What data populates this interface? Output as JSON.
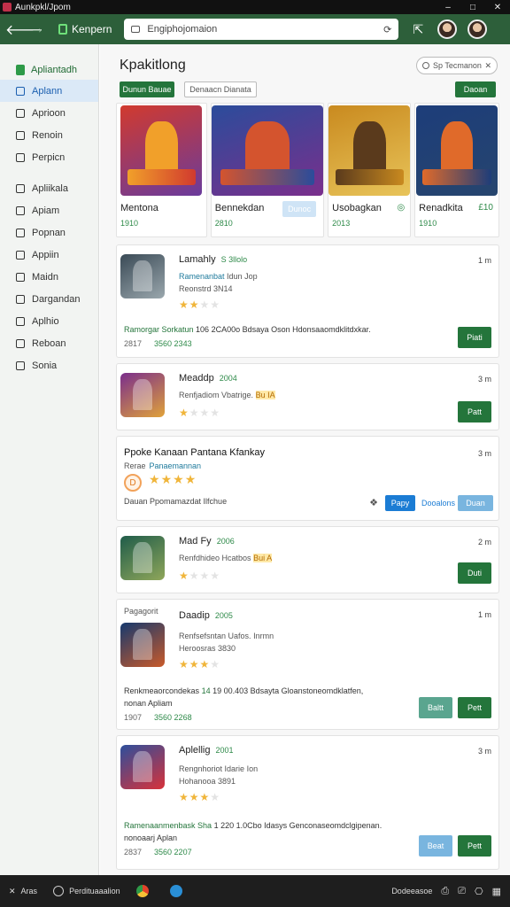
{
  "window": {
    "title": "Aunkpkl/Jpom",
    "min": "–",
    "max": "□",
    "close": "✕"
  },
  "toolbar": {
    "back": "🡐",
    "forward": "→",
    "tab_label": "Kenpern",
    "address": "Engiphojomaion",
    "refresh": "⟳"
  },
  "sidebar": {
    "brand": "Apliantadh",
    "items": [
      "Aplann",
      "Aprioon",
      "Renoin",
      "Perpicn",
      "Apliikala",
      "Apiam",
      "Popnan",
      "Appiin",
      "Maidn",
      "Dargandan",
      "Aplhio",
      "Reboan",
      "Sonia"
    ]
  },
  "main": {
    "title": "Kpakitlong",
    "search": "Sp Tecmanon",
    "chip_primary": "Dunun Bauae",
    "chip_secondary": "Denaacn Dianata",
    "chip_right": "Daoan"
  },
  "featured": [
    {
      "name": "Mentona",
      "sub": "1910",
      "colors": [
        "#d13a2e",
        "#f1a02a",
        "#6a3b9c"
      ]
    },
    {
      "name": "Bennekdan",
      "sub": "2810",
      "button": "Dunoc",
      "colors": [
        "#2b4c9b",
        "#d4542e",
        "#7a2f8c"
      ]
    },
    {
      "name": "Usobagkan",
      "sub": "2013",
      "mark": "◎",
      "colors": [
        "#c98a1f",
        "#5a3a1c",
        "#e8c45a"
      ]
    },
    {
      "name": "Renadkita",
      "sub": "1910",
      "mark": "£10",
      "colors": [
        "#1d3d7a",
        "#e06a2a",
        "#26456e"
      ]
    }
  ],
  "apps": [
    {
      "name": "Lamahly",
      "tag": "S 3llolo",
      "sub_hl": "Ramenanbat",
      "sub_rest": " Idun Jop",
      "sub2": "Reonstrd 3N14",
      "rating": 2,
      "desc_g": "Ramorgar Sorkatun",
      "desc_rest": " 106 2CA00o Bdsaya Oson Hdonsaaomdklitdxkar.",
      "meta1": "2817",
      "meta2": "3560 2343",
      "size": "1 m",
      "button": "Piati",
      "colors": [
        "#3a4a56",
        "#9aa7ad"
      ]
    },
    {
      "name": "Meaddp",
      "tag": "2004",
      "sub_text": "Renfjadiom Vbatrige.",
      "sub_hl2": "Bu IA",
      "rating": 1,
      "size": "3 m",
      "button": "Patt",
      "colors": [
        "#7a2e8c",
        "#e0a23a"
      ]
    },
    {
      "name": "Mad Fy",
      "tag": "2006",
      "sub_text": "Renfdhideo Hcatbos",
      "sub_hl2": "Bui A",
      "rating": 1,
      "size": "2 m",
      "button": "Duti",
      "colors": [
        "#1f5c4a",
        "#8fa65a"
      ]
    },
    {
      "name": "Daadip",
      "tag": "2005",
      "label_top": "Pagagorit",
      "sub_text": "Renfsefsntan Uafos.",
      "sub_text_b": "Inrmn",
      "sub2": "Heroosras 3830",
      "rating": 3,
      "desc_g": "14",
      "desc_a": "Renkmeaorcondekas",
      "desc_rest": " 19 00.403 Bdsayta Gloanstoneomdklatfen,",
      "desc2": "nonan Apliam",
      "meta1": "1907",
      "meta2": "3560 2268",
      "size": "1 m",
      "button": "Pett",
      "button2": "Baltt",
      "colors": [
        "#16396e",
        "#c95a2a"
      ]
    },
    {
      "name": "Aplellig",
      "tag": "2001",
      "sub_text": "Rengnhoriot Idarie",
      "sub_text_b": "Ion",
      "sub2": "Hohanooa 3891",
      "rating": 3,
      "desc_g": "Ramenaanmenbask Sha",
      "desc_rest": " 1 220 1.0Cbo Idasys Genconaseomdclgipenan.",
      "desc2": "nonoaarj Aplan",
      "meta1": "2837",
      "meta2": "3560 2207",
      "size": "3 m",
      "button": "Pett",
      "button2": "Beat",
      "colors": [
        "#2d4f9c",
        "#d8323a"
      ]
    }
  ],
  "promo": {
    "title": "Ppoke Kanaan Pantana Kfankay",
    "sub": "Rerae",
    "sub_hl": "Panaemannan",
    "coin": "D",
    "rating": 4,
    "desc": "Dauan Ppomamazdat Ilfchue",
    "size": "3 m",
    "btn_blue": "Papy",
    "btn_link": "Dooalons",
    "btn_light": "Duan"
  },
  "taskbar": {
    "start": "Aras",
    "app": "Perdituaaalion",
    "clock": "Dodeeasoe",
    "tray": [
      "⎙",
      "⎚",
      "⎔",
      "▦"
    ]
  }
}
